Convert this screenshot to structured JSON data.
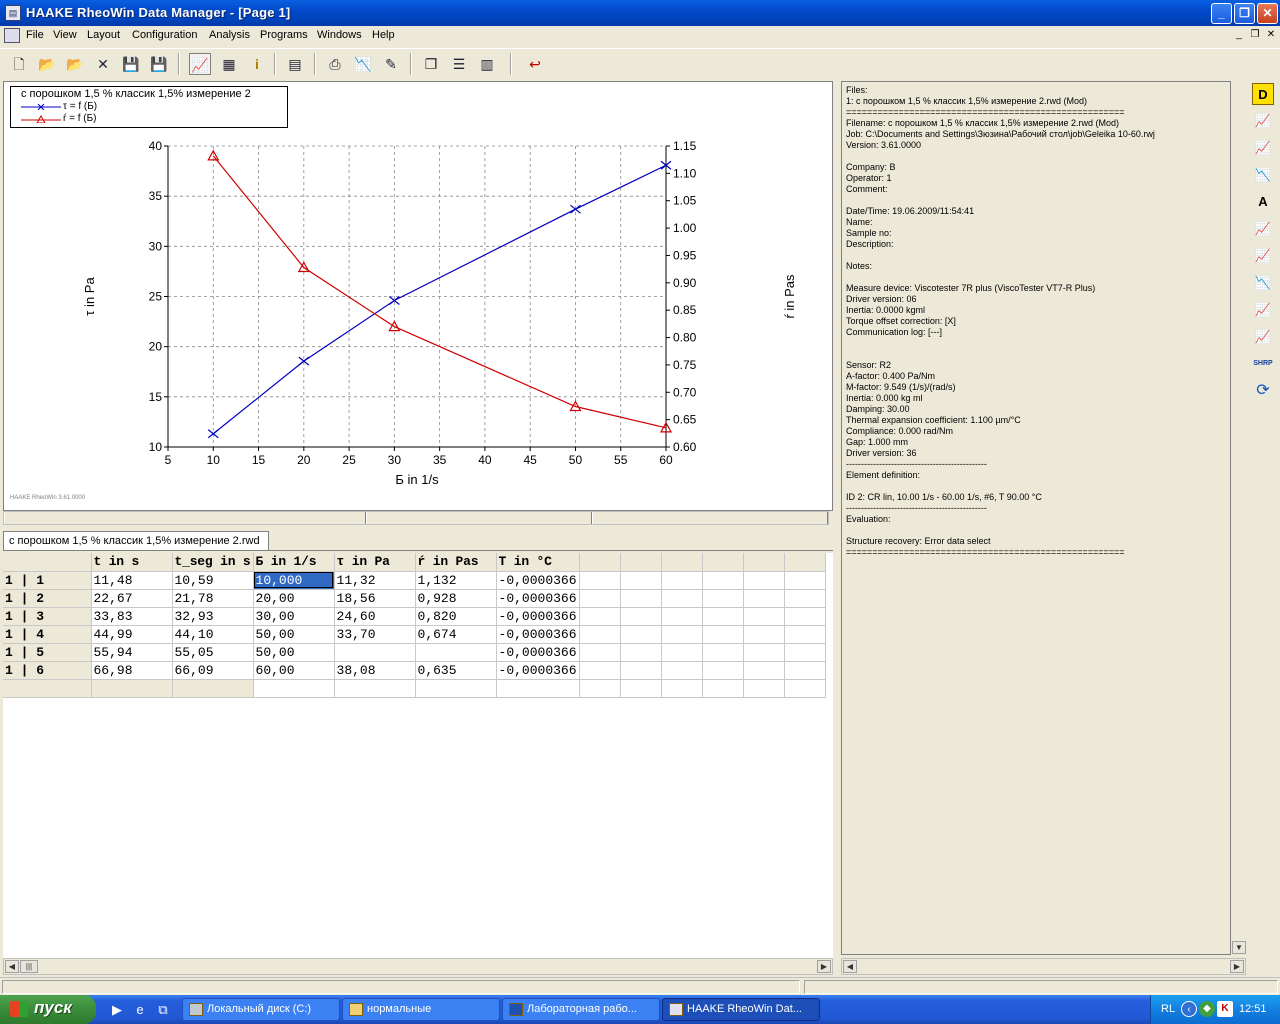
{
  "window": {
    "title": "HAAKE RheoWin Data Manager - [Page 1]"
  },
  "menu": [
    "File",
    "View",
    "Layout",
    "Configuration",
    "Analysis",
    "Programs",
    "Windows",
    "Help"
  ],
  "toolbar_icons": [
    "new-file-icon",
    "open-folder-icon",
    "open-multi-icon",
    "delete-icon",
    "save-icon",
    "save-all-icon",
    "chart-view-icon",
    "table-view-icon",
    "info-icon",
    "print-preview-icon",
    "print-icon",
    "chart-setup-icon",
    "edit-icon",
    "cascade-icon",
    "tile-horizontal-icon",
    "tile-vertical-icon",
    "exit-icon"
  ],
  "chart_data": {
    "type": "line",
    "legend_title": "с порошком 1,5 % классик 1,5% измерение 2",
    "xlabel": "Б in 1/s",
    "ylabel_left": "τ in Pa",
    "ylabel_right": "ŕ in Pas",
    "xlim": [
      5,
      60
    ],
    "ylim_left": [
      10,
      40
    ],
    "ylim_right": [
      0.6,
      1.15
    ],
    "x_ticks": [
      "5",
      "10",
      "15",
      "20",
      "25",
      "30",
      "35",
      "40",
      "45",
      "50",
      "55",
      "60"
    ],
    "y_left_ticks": [
      "10",
      "15",
      "20",
      "25",
      "30",
      "35",
      "40"
    ],
    "y_right_ticks": [
      "0.60",
      "0.65",
      "0.70",
      "0.75",
      "0.80",
      "0.85",
      "0.90",
      "0.95",
      "1.00",
      "1.05",
      "1.10",
      "1.15"
    ],
    "grid": true,
    "watermark": "HAAKE RheoWin 3.61.0000",
    "series": [
      {
        "name": "τ = f (Б)",
        "axis": "left",
        "color": "#0000c0",
        "marker": "x",
        "x": [
          10,
          20,
          30,
          50,
          60
        ],
        "y": [
          11.32,
          18.56,
          24.6,
          33.7,
          38.08
        ]
      },
      {
        "name": "ŕ = f (Б)",
        "axis": "right",
        "color": "#d00000",
        "marker": "triangle",
        "x": [
          10,
          20,
          30,
          50,
          60
        ],
        "y": [
          1.132,
          0.928,
          0.82,
          0.674,
          0.635
        ]
      }
    ]
  },
  "file_tab": "с порошком 1,5 % классик 1,5% измерение 2.rwd",
  "table": {
    "headers": [
      "",
      "t in s",
      "t_seg in s",
      "Б in 1/s",
      "τ in Pa",
      "ŕ in Pas",
      "T in °C",
      "",
      "",
      "",
      "",
      "",
      ""
    ],
    "rows": [
      [
        "1 | 1",
        "11,48",
        "10,59",
        "10,000",
        "11,32",
        "1,132",
        "-0,0000366"
      ],
      [
        "1 | 2",
        "22,67",
        "21,78",
        "20,00",
        "18,56",
        "0,928",
        "-0,0000366"
      ],
      [
        "1 | 3",
        "33,83",
        "32,93",
        "30,00",
        "24,60",
        "0,820",
        "-0,0000366"
      ],
      [
        "1 | 4",
        "44,99",
        "44,10",
        "50,00",
        "33,70",
        "0,674",
        "-0,0000366"
      ],
      [
        "1 | 5",
        "55,94",
        "55,05",
        "50,00",
        "",
        "",
        "-0,0000366"
      ],
      [
        "1 | 6",
        "66,98",
        "66,09",
        "60,00",
        "38,08",
        "0,635",
        "-0,0000366"
      ]
    ]
  },
  "info_lines": [
    "Files:",
    "1: с порошком 1,5 % классик 1,5% измерение 2.rwd (Mod)",
    "=====================================================",
    "Filename: с порошком 1,5 % классик 1,5% измерение 2.rwd (Mod)",
    "Job: C:\\Documents and Settings\\Зюзина\\Рабочий стол\\job\\Geleika 10-60.rwj",
    "Version: 3.61.0000",
    "",
    "Company: B",
    "Operator: 1",
    "Comment:",
    "",
    "Date/Time: 19.06.2009/11:54:41",
    "Name:",
    "Sample no:",
    "Description:",
    "",
    "Notes:",
    "",
    "Measure device: Viscotester 7R plus (ViscoTester VT7-R Plus)",
    "Driver version: 06",
    "Inertia: 0.0000 kgml",
    "Torque offset correction: [X]",
    "Communication log: [---]",
    "",
    "",
    "Sensor: R2",
    "A-factor: 0.400 Pa/Nm",
    "M-factor: 9.549 (1/s)/(rad/s)",
    "Inertia: 0.000 kg ml",
    "Damping: 30.00",
    "Thermal expansion coefficient: 1.100 µm/°C",
    "Compliance: 0.000 rad/Nm",
    "Gap: 1.000 mm",
    "Driver version: 36",
    "-----------------------------------------------",
    "Element definition:",
    "",
    "ID 2: CR lin, 10.00 1/s - 60.00 1/s, #6, T 90.00 °C",
    "-----------------------------------------------",
    "Evaluation:",
    "",
    "Structure recovery: Error data select",
    "====================================================="
  ],
  "right_icons": [
    "d-logo-icon",
    "graph-icon-1",
    "graph-icon-2",
    "graph-icon-3",
    "graph-a-icon",
    "graph-icon-4",
    "graph-icon-5",
    "graph-icon-6",
    "graph-icon-7",
    "graph-icon-8",
    "shrp-icon",
    "rotate-icon"
  ],
  "right_icon_labels": {
    "d": "D",
    "a": "A",
    "shrp": "SHRP"
  },
  "taskbar": {
    "start": "пуск",
    "tasks": [
      "Локальный диск (C:)",
      "нормальные",
      "Лабораторная рабо...",
      "HAAKE RheoWin Dat..."
    ],
    "lang": "RL",
    "clock": "12:51"
  }
}
